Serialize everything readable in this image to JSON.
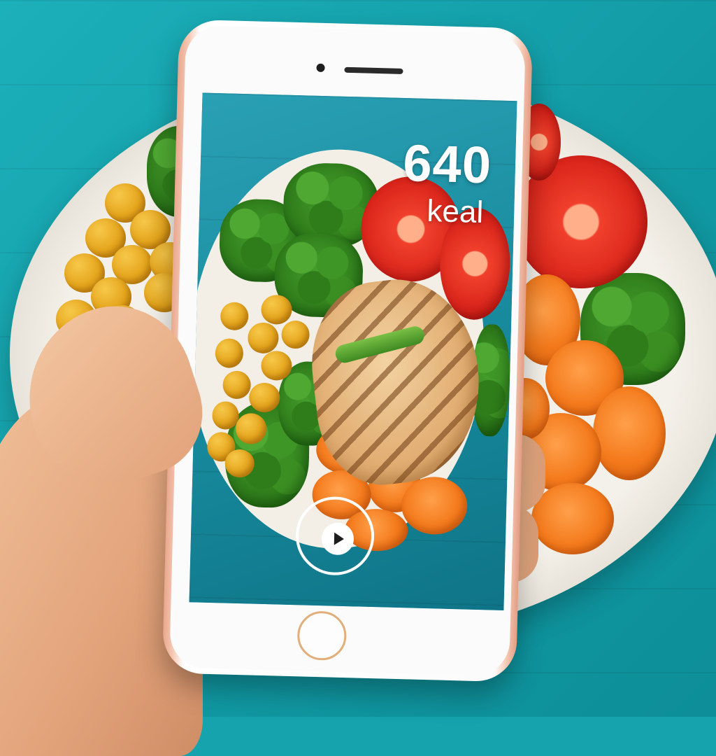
{
  "calorie_display": {
    "value": "640",
    "unit": "keal"
  },
  "video_control": {
    "icon": "play-icon"
  },
  "colors": {
    "table": "#16a3ad",
    "phone_frame": "#ffffff",
    "phone_accent": "#e9a78e",
    "calorie_text": "#ffffff"
  }
}
